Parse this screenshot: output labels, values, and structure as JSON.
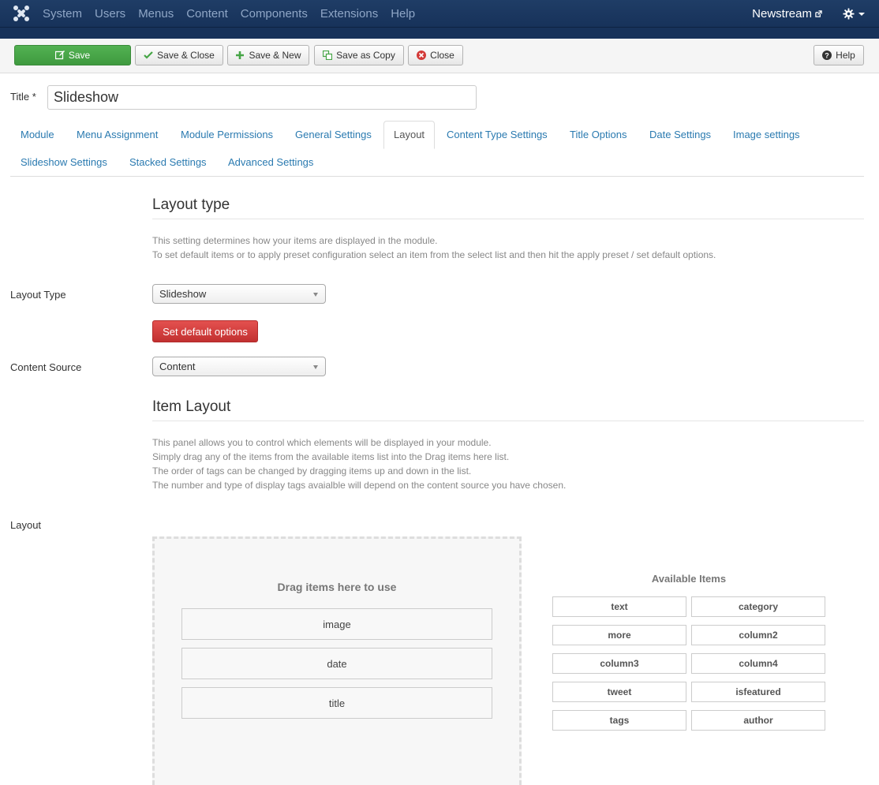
{
  "nav": {
    "items": [
      "System",
      "Users",
      "Menus",
      "Content",
      "Components",
      "Extensions",
      "Help"
    ],
    "site_name": "Newstream"
  },
  "toolbar": {
    "save": "Save",
    "save_close": "Save & Close",
    "save_new": "Save & New",
    "save_copy": "Save as Copy",
    "close": "Close",
    "help": "Help"
  },
  "title_field": {
    "label": "Title *",
    "value": "Slideshow"
  },
  "tabs": {
    "row1": [
      "Module",
      "Menu Assignment",
      "Module Permissions",
      "General Settings",
      "Layout",
      "Content Type Settings",
      "Title Options",
      "Date Settings",
      "Image settings"
    ],
    "row2": [
      "Slideshow Settings",
      "Stacked Settings",
      "Advanced Settings"
    ],
    "active": "Layout"
  },
  "layout_type_section": {
    "title": "Layout type",
    "desc_line1": "This setting determines how your items are displayed in the module.",
    "desc_line2": "To set default items or to apply preset configuration select an item from the select list and then hit the apply preset / set default options.",
    "layout_type_label": "Layout Type",
    "layout_type_value": "Slideshow",
    "set_default_button": "Set default options",
    "content_source_label": "Content Source",
    "content_source_value": "Content"
  },
  "item_layout_section": {
    "title": "Item Layout",
    "desc_line1": "This panel allows you to control which elements will be displayed in your module.",
    "desc_line2": "Simply drag any of the items from the available items list into the Drag items here list.",
    "desc_line3": "The order of tags can be changed by dragging items up and down in the list.",
    "desc_line4": "The number and type of display tags avaialble will depend on the content source you have chosen.",
    "layout_label": "Layout",
    "drop_title": "Drag items here to use",
    "used_items": [
      "image",
      "date",
      "title"
    ],
    "available_title": "Available Items",
    "available_items": [
      "text",
      "category",
      "more",
      "column2",
      "column3",
      "column4",
      "tweet",
      "isfeatured",
      "tags",
      "author"
    ]
  },
  "colors": {
    "navbar": "#1b3760",
    "link": "#2a7ab0",
    "save_green": "#46a546",
    "danger_red": "#d33a38"
  }
}
